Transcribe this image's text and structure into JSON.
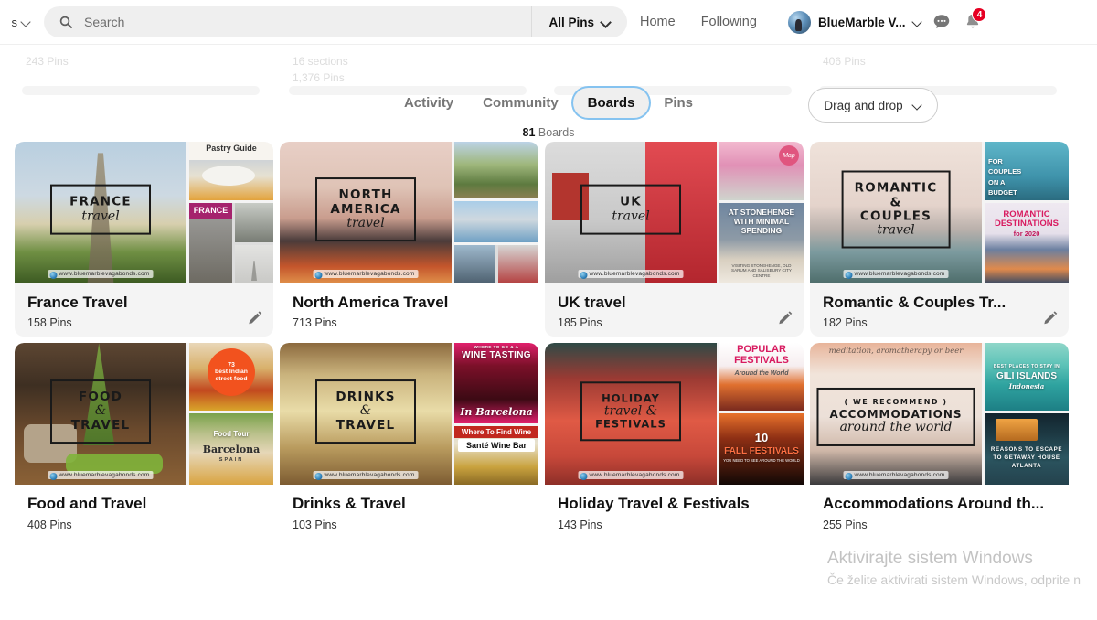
{
  "header": {
    "left_chevron_label": "s",
    "search": {
      "placeholder": "Search",
      "value": "",
      "icon": "search-icon"
    },
    "scope_filter": {
      "label": "All Pins",
      "icon": "chevron-down-icon"
    },
    "nav": [
      {
        "label": "Home",
        "name": "home"
      },
      {
        "label": "Following",
        "name": "following"
      }
    ],
    "account": {
      "name": "BlueMarble V...",
      "icon": "chevron-down-icon",
      "avatar": "avatar"
    },
    "messages_icon": "message-bubble-icon",
    "notifications_icon": "bell-icon",
    "notifications_count": "4",
    "badge_color": "#e60023"
  },
  "ghost": {
    "pins_left": "243 Pins",
    "sections_mid": "16 sections",
    "pins_mid": "1,376 Pins",
    "pins_right": "406 Pins"
  },
  "tabs": [
    {
      "label": "Activity",
      "active": false
    },
    {
      "label": "Community",
      "active": false
    },
    {
      "label": "Boards",
      "active": true
    },
    {
      "label": "Pins",
      "active": false
    }
  ],
  "tab_focus_color": "#85c3f0",
  "summary": {
    "count": "81",
    "noun": "Boards"
  },
  "sort_control": {
    "label": "Drag and drop",
    "icon": "chevron-down-icon"
  },
  "boards": [
    {
      "title": "France Travel",
      "pins": "158 Pins",
      "has_edit": true,
      "cover": {
        "line1": "FRANCE",
        "line2": "travel",
        "watermark": "www.bluemarblevagabonds.com"
      },
      "thumbs": [
        {
          "caption": "Pastry Guide",
          "caption_color": "#333"
        },
        {
          "caption": "FRANCE",
          "caption_color": "#ffffff"
        },
        {
          "caption": "",
          "caption_color": "#ffffff"
        }
      ]
    },
    {
      "title": "North America Travel",
      "pins": "713 Pins",
      "has_edit": false,
      "cover": {
        "line1": "NORTH AMERICA",
        "line2": "travel",
        "watermark": "www.bluemarblevagabonds.com"
      },
      "thumbs": [
        {
          "caption": "",
          "caption_color": "#ffffff"
        },
        {
          "caption": "",
          "caption_color": "#ffffff"
        },
        {
          "caption": "",
          "caption_color": "#ffffff"
        }
      ]
    },
    {
      "title": "UK travel",
      "pins": "185 Pins",
      "has_edit": true,
      "cover": {
        "line1": "UK",
        "line2": "travel",
        "watermark": "www.bluemarblevagabonds.com"
      },
      "thumbs": [
        {
          "caption": "Map",
          "caption_color": "#ffffff"
        },
        {
          "caption": "AT STONEHENGE WITH MINIMAL SPENDING",
          "caption_color": "#ffffff",
          "subcaption": "VISITING STONEHENGE, OLD SARUM AND SALISBURY CITY CENTRE"
        }
      ]
    },
    {
      "title": "Romantic & Couples Tr...",
      "pins": "182 Pins",
      "has_edit": true,
      "cover": {
        "line1": "ROMANTIC & COUPLES",
        "line2": "travel",
        "watermark": "www.bluemarblevagabonds.com"
      },
      "thumbs": [
        {
          "caption": "FOR COUPLES ON A BUDGET",
          "caption_color": "#ffffff"
        },
        {
          "caption": "ROMANTIC DESTINATIONS",
          "caption2": "for 2020",
          "caption_color": "#ffffff"
        }
      ]
    },
    {
      "title": "Food and Travel",
      "pins": "408 Pins",
      "has_edit": false,
      "cover": {
        "line1": "FOOD",
        "line1b": "&",
        "line2": "TRAVEL",
        "watermark": "www.bluemarblevagabonds.com"
      },
      "thumbs": [
        {
          "caption": "best Indian street food",
          "badge": "73",
          "caption_color": "#ffffff"
        },
        {
          "caption": "Food Tour",
          "caption2": "Barcelona",
          "caption3": "SPAIN",
          "caption_color": "#ffffff"
        }
      ]
    },
    {
      "title": "Drinks & Travel",
      "pins": "103 Pins",
      "has_edit": false,
      "cover": {
        "line1": "DRINKS",
        "line1b": "&",
        "line2": "TRAVEL",
        "watermark": "www.bluemarblevagabonds.com"
      },
      "thumbs": [
        {
          "caption": "WINE TASTING",
          "supercaption": "WHERE TO GO & A",
          "caption2": "In Barcelona",
          "caption_color": "#ffffff"
        },
        {
          "caption": "Where To Find Wine",
          "caption2": "Santé Wine Bar",
          "caption_color": "#ffffff"
        }
      ]
    },
    {
      "title": "Holiday Travel & Festivals",
      "pins": "143 Pins",
      "has_edit": false,
      "cover": {
        "line1": "HOLIDAY",
        "line2": "travel &",
        "line3": "FESTIVALS",
        "watermark": "www.bluemarblevagabonds.com"
      },
      "thumbs": [
        {
          "caption": "POPULAR FESTIVALS",
          "caption2": "Around the World",
          "caption_color": "#c2185b"
        },
        {
          "badge": "10",
          "caption": "FALL FESTIVALS",
          "caption2": "YOU NEED TO SEE AROUND THE WORLD",
          "caption_color": "#ff7043"
        }
      ]
    },
    {
      "title": "Accommodations Around th...",
      "pins": "255 Pins",
      "has_edit": false,
      "cover": {
        "line0": "( WE RECOMMEND )",
        "line1": "ACCOMMODATIONS",
        "line2": "around the world",
        "top_script": "meditation, aromatherapy or beer",
        "watermark": "www.bluemarblevagabonds.com"
      },
      "thumbs": [
        {
          "supercaption": "BEST PLACES TO STAY IN",
          "caption": "GILI ISLANDS",
          "caption2": "Indonesia",
          "caption_color": "#ffffff"
        },
        {
          "caption": "REASONS TO ESCAPE TO GETAWAY HOUSE ATLANTA",
          "caption_color": "#ffffff"
        }
      ]
    }
  ],
  "windows_watermark": {
    "line1": "Aktivirajte sistem Windows",
    "line2": "Če želite aktivirati sistem Windows, odprite n"
  }
}
